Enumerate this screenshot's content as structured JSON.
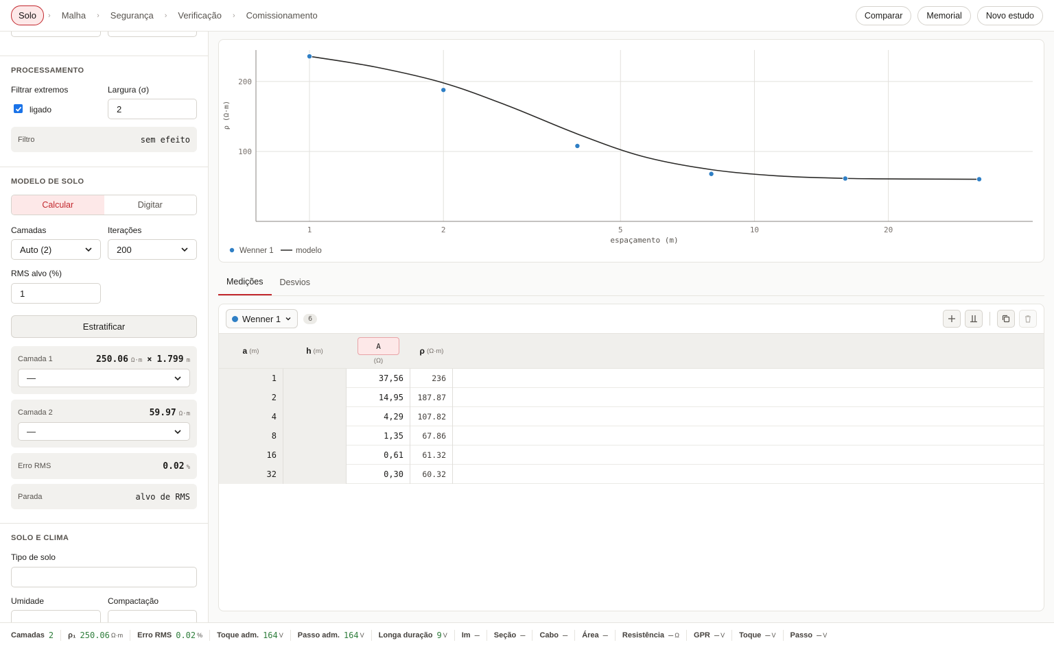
{
  "steps": [
    "Solo",
    "Malha",
    "Segurança",
    "Verificação",
    "Comissionamento"
  ],
  "top_actions": {
    "compare": "Comparar",
    "memorial": "Memorial",
    "new_study": "Novo estudo"
  },
  "processamento": {
    "title": "PROCESSAMENTO",
    "filter_label": "Filtrar extremos",
    "filter_checked": true,
    "filter_state": "ligado",
    "width_label": "Largura (σ)",
    "width_value": "2",
    "filter_info_key": "Filtro",
    "filter_info_value": "sem efeito"
  },
  "modelo": {
    "title": "MODELO DE SOLO",
    "mode_calc": "Calcular",
    "mode_type": "Digitar",
    "layers_label": "Camadas",
    "layers_value": "Auto (2)",
    "iterations_label": "Iterações",
    "iterations_value": "200",
    "rms_label": "RMS alvo (%)",
    "rms_value": "1",
    "stratify_button": "Estratificar",
    "layer1": {
      "label": "Camada 1",
      "rho": "250.06",
      "rho_unit": "Ω·m",
      "times": "×",
      "h": "1.799",
      "h_unit": "m",
      "select": "—"
    },
    "layer2": {
      "label": "Camada 2",
      "rho": "59.97",
      "rho_unit": "Ω·m",
      "select": "—"
    },
    "rms_error": {
      "label": "Erro RMS",
      "value": "0.02",
      "unit": "%"
    },
    "stop": {
      "label": "Parada",
      "value": "alvo de RMS"
    }
  },
  "solo_clima": {
    "title": "SOLO E CLIMA",
    "soil_type_label": "Tipo de solo",
    "humidity_label": "Umidade",
    "compaction_label": "Compactação"
  },
  "chart_data": {
    "type": "line",
    "xscale": "log",
    "xlabel": "espaçamento (m)",
    "ylabel": "ρ (Ω·m)",
    "x_ticks": [
      1,
      2,
      5,
      10,
      20
    ],
    "y_ticks": [
      100,
      200
    ],
    "xlim": [
      1,
      32
    ],
    "ylim": [
      0,
      245
    ],
    "grid": true,
    "legend_position": "bottom-left",
    "series": [
      {
        "name": "Wenner 1",
        "kind": "points",
        "color": "#2f7fc5",
        "x": [
          1,
          2,
          4,
          8,
          16,
          32
        ],
        "y": [
          236,
          187.87,
          107.82,
          67.86,
          61.32,
          60.32
        ]
      },
      {
        "name": "modelo",
        "kind": "line",
        "color": "#2b2a28",
        "x": [
          1,
          1.4,
          2,
          2.8,
          4,
          5.6,
          8,
          11.3,
          16,
          22.6,
          32
        ],
        "y": [
          236,
          221,
          198,
          165,
          125,
          93,
          74,
          65,
          61.5,
          60.6,
          60.2
        ]
      }
    ]
  },
  "tabs": [
    "Medições",
    "Desvios"
  ],
  "measurements": {
    "series_name": "Wenner 1",
    "count": "6",
    "columns": [
      {
        "name": "a",
        "unit": "(m)"
      },
      {
        "name": "h",
        "unit": "(m)"
      },
      {
        "name": "A",
        "unit": "(Ω)"
      },
      {
        "name": "ρ",
        "unit": "(Ω·m)"
      }
    ],
    "rows": [
      {
        "a": "1",
        "h": "",
        "A": "37,56",
        "rho": "236"
      },
      {
        "a": "2",
        "h": "",
        "A": "14,95",
        "rho": "187.87"
      },
      {
        "a": "4",
        "h": "",
        "A": "4,29",
        "rho": "107.82"
      },
      {
        "a": "8",
        "h": "",
        "A": "1,35",
        "rho": "67.86"
      },
      {
        "a": "16",
        "h": "",
        "A": "0,61",
        "rho": "61.32"
      },
      {
        "a": "32",
        "h": "",
        "A": "0,30",
        "rho": "60.32"
      }
    ]
  },
  "status": [
    {
      "label": "Camadas",
      "value": "2",
      "unit": ""
    },
    {
      "label": "ρ₁",
      "value": "250.06",
      "unit": "Ω·m"
    },
    {
      "label": "Erro RMS",
      "value": "0.02",
      "unit": "%"
    },
    {
      "label": "Toque adm.",
      "value": "164",
      "unit": "V"
    },
    {
      "label": "Passo adm.",
      "value": "164",
      "unit": "V"
    },
    {
      "label": "Longa duração",
      "value": "9",
      "unit": "V"
    },
    {
      "label": "Im",
      "value": "—",
      "unit": ""
    },
    {
      "label": "Seção",
      "value": "—",
      "unit": ""
    },
    {
      "label": "Cabo",
      "value": "—",
      "unit": ""
    },
    {
      "label": "Área",
      "value": "—",
      "unit": ""
    },
    {
      "label": "Resistência",
      "value": "—",
      "unit": "Ω"
    },
    {
      "label": "GPR",
      "value": "—",
      "unit": "V"
    },
    {
      "label": "Toque",
      "value": "—",
      "unit": "V"
    },
    {
      "label": "Passo",
      "value": "—",
      "unit": "V"
    }
  ]
}
